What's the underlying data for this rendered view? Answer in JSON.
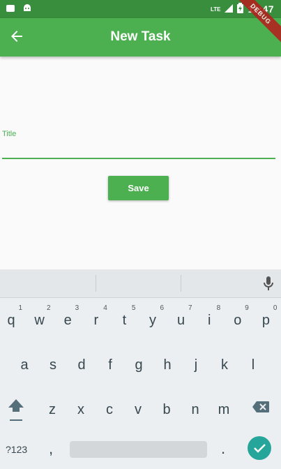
{
  "status_bar": {
    "network_label": "LTE",
    "time": "11:47"
  },
  "app_bar": {
    "title": "New Task"
  },
  "debug_banner": {
    "label": "DEBUG"
  },
  "form": {
    "title_label": "Title",
    "title_value": "",
    "save_label": "Save"
  },
  "keyboard": {
    "row1": [
      {
        "ch": "q",
        "num": "1"
      },
      {
        "ch": "w",
        "num": "2"
      },
      {
        "ch": "e",
        "num": "3"
      },
      {
        "ch": "r",
        "num": "4"
      },
      {
        "ch": "t",
        "num": "5"
      },
      {
        "ch": "y",
        "num": "6"
      },
      {
        "ch": "u",
        "num": "7"
      },
      {
        "ch": "i",
        "num": "8"
      },
      {
        "ch": "o",
        "num": "9"
      },
      {
        "ch": "p",
        "num": "0"
      }
    ],
    "row2": [
      "a",
      "s",
      "d",
      "f",
      "g",
      "h",
      "j",
      "k",
      "l"
    ],
    "row3": [
      "z",
      "x",
      "c",
      "v",
      "b",
      "n",
      "m"
    ],
    "bottom": {
      "symbols_label": "?123",
      "comma": ",",
      "period": "."
    }
  },
  "colors": {
    "primary": "#4caf50",
    "primary_dark": "#388e3c",
    "accent_enter": "#26a69a",
    "debug": "#b71c1c"
  }
}
